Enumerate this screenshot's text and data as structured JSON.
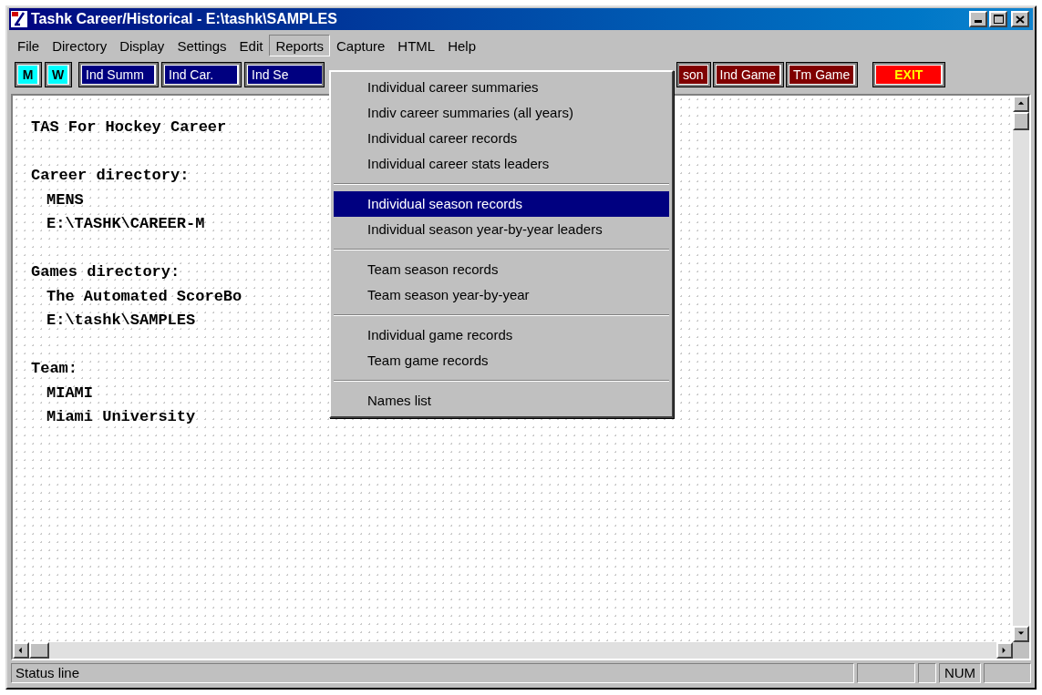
{
  "window": {
    "title": "Tashk Career/Historical - E:\\tashk\\SAMPLES"
  },
  "menu_bar": [
    {
      "label": "File",
      "selected": false
    },
    {
      "label": "Directory",
      "selected": false
    },
    {
      "label": "Display",
      "selected": false
    },
    {
      "label": "Settings",
      "selected": false
    },
    {
      "label": "Edit",
      "selected": false
    },
    {
      "label": "Reports",
      "selected": true
    },
    {
      "label": "Capture",
      "selected": false
    },
    {
      "label": "HTML",
      "selected": false
    },
    {
      "label": "Help",
      "selected": false
    }
  ],
  "toolbar_left": [
    {
      "label": "M",
      "kind": "letter"
    },
    {
      "label": "W",
      "kind": "letter"
    },
    {
      "label": "Ind Summ",
      "kind": "navy"
    },
    {
      "label": "Ind Car.",
      "kind": "navy"
    },
    {
      "label": "Ind Se",
      "kind": "navy"
    }
  ],
  "toolbar_right": [
    {
      "label": "son",
      "kind": "maroon"
    },
    {
      "label": "Ind Game",
      "kind": "maroon"
    },
    {
      "label": "Tm Game",
      "kind": "maroon"
    },
    {
      "label": "EXIT",
      "kind": "exit"
    }
  ],
  "content": {
    "title": "TAS For Hockey Career",
    "sections": [
      {
        "heading": "Career directory:",
        "lines": [
          "MENS",
          "E:\\TASHK\\CAREER-M"
        ]
      },
      {
        "heading": "Games directory:",
        "lines": [
          "The Automated ScoreBo",
          "E:\\tashk\\SAMPLES"
        ]
      },
      {
        "heading": "Team:",
        "lines": [
          "MIAMI",
          "Miami University"
        ]
      }
    ]
  },
  "reports_menu": [
    {
      "kind": "item",
      "label": "Individual career summaries",
      "selected": false
    },
    {
      "kind": "item",
      "label": "Indiv career summaries (all years)",
      "selected": false
    },
    {
      "kind": "item",
      "label": "Individual career records",
      "selected": false
    },
    {
      "kind": "item",
      "label": "Individual career stats leaders",
      "selected": false
    },
    {
      "kind": "separator"
    },
    {
      "kind": "item",
      "label": "Individual season records",
      "selected": true
    },
    {
      "kind": "item",
      "label": "Individual season year-by-year leaders",
      "selected": false
    },
    {
      "kind": "separator"
    },
    {
      "kind": "item",
      "label": "Team season records",
      "selected": false
    },
    {
      "kind": "item",
      "label": "Team season year-by-year",
      "selected": false
    },
    {
      "kind": "separator"
    },
    {
      "kind": "item",
      "label": "Individual game records",
      "selected": false
    },
    {
      "kind": "item",
      "label": "Team game records",
      "selected": false
    },
    {
      "kind": "separator"
    },
    {
      "kind": "item",
      "label": "Names list",
      "selected": false
    }
  ],
  "status_bar": {
    "message": "Status line",
    "panels": [
      {
        "kind": "blank"
      },
      {
        "kind": "blank"
      },
      {
        "kind": "text",
        "label": "NUM"
      },
      {
        "kind": "blank"
      }
    ]
  }
}
